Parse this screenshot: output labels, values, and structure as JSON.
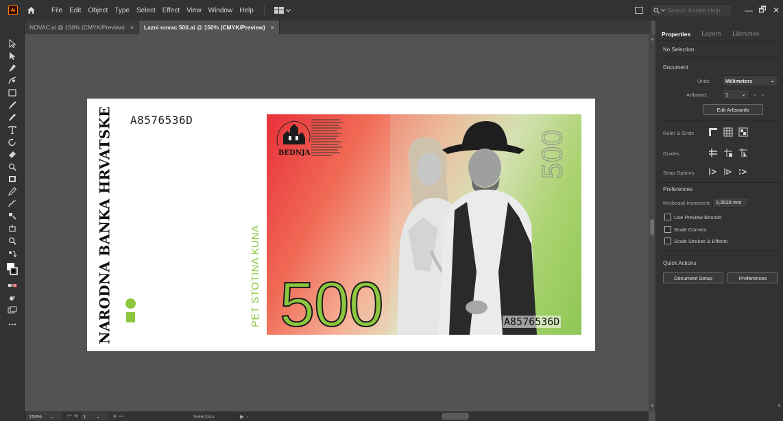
{
  "app": {
    "logo": "Ai",
    "menu": [
      "File",
      "Edit",
      "Object",
      "Type",
      "Select",
      "Effect",
      "View",
      "Window",
      "Help"
    ],
    "search_placeholder": "Search Adobe Help",
    "window_controls": [
      "—",
      "🗗",
      "✕"
    ]
  },
  "tabs": [
    {
      "label": "NOVAC.ai @ 150% (CMYK/Preview)",
      "close": "×",
      "active": false
    },
    {
      "label": "Lazni novac 500.ai @ 150% (CMYK/Preview)",
      "close": "×",
      "active": true
    }
  ],
  "tools": [
    "selection-tool-icon",
    "direct-selection-tool-icon",
    "pen-tool-icon",
    "curvature-tool-icon",
    "rectangle-tool-icon",
    "paintbrush-tool-icon",
    "pencil-tool-icon",
    "type-tool-icon",
    "rotate-tool-icon",
    "eraser-tool-icon",
    "scale-tool-icon",
    "width-tool-icon",
    "shape-builder-tool-icon",
    "gradient-tool-icon",
    "eyedropper-tool-icon",
    "blend-tool-icon",
    "symbol-sprayer-tool-icon",
    "artboard-tool-icon",
    "zoom-tool-icon"
  ],
  "banknote": {
    "issuer": "NARODNA BANKA HRVATSKE",
    "serial_top": "A8576536D",
    "serial_bottom": "A8576536D",
    "value_big": "500",
    "value_vertical": "500",
    "value_words": "PET STOTINA KUNA",
    "emblem_caption": "BEDNJA",
    "colors": {
      "green": "#8dc63f",
      "red": "#e8303a"
    }
  },
  "panel": {
    "tabs": [
      "Properties",
      "Layers",
      "Libraries"
    ],
    "selection_state": "No Selection",
    "document": {
      "heading": "Document",
      "units_label": "Units:",
      "units_value": "Millimeters",
      "artboard_label": "Artboard:",
      "artboard_value": "1",
      "edit_artboards": "Edit Artboards"
    },
    "ruler_grids": "Ruler & Grids",
    "guides": "Guides",
    "snap_options": "Snap Options",
    "preferences": {
      "heading": "Preferences",
      "keyboard_increment_label": "Keyboard Increment:",
      "keyboard_increment_value": "0,3528 mm",
      "checkboxes": [
        "Use Preview Bounds",
        "Scale Corners",
        "Scale Strokes & Effects"
      ]
    },
    "quick_actions": {
      "heading": "Quick Actions",
      "document_setup": "Document Setup",
      "preferences_button": "Preferences"
    }
  },
  "status": {
    "zoom": "150%",
    "page": "1",
    "tool": "Selection"
  }
}
